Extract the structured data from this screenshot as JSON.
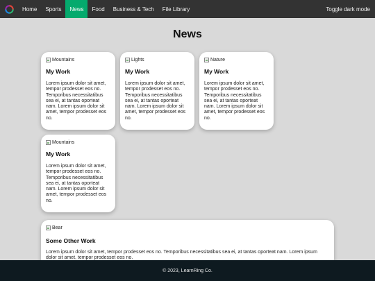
{
  "nav": {
    "items": [
      {
        "label": "Home"
      },
      {
        "label": "Sports"
      },
      {
        "label": "News"
      },
      {
        "label": "Food"
      },
      {
        "label": "Business & Tech"
      },
      {
        "label": "File Library"
      }
    ],
    "active": "News",
    "toggle_label": "Toggle dark mode"
  },
  "page": {
    "title": "News"
  },
  "cards": [
    {
      "image_alt": "Mountains",
      "title": "My Work",
      "text": "Lorem ipsum dolor sit amet, tempor prodesset eos no. Temporibus necessitatibus sea ei, at tantas oporteat nam. Lorem ipsum dolor sit amet, tempor prodesset eos no."
    },
    {
      "image_alt": "Lights",
      "title": "My Work",
      "text": "Lorem ipsum dolor sit amet, tempor prodesset eos no. Temporibus necessitatibus sea ei, at tantas oporteat nam. Lorem ipsum dolor sit amet, tempor prodesset eos no."
    },
    {
      "image_alt": "Nature",
      "title": "My Work",
      "text": "Lorem ipsum dolor sit amet, tempor prodesset eos no. Temporibus necessitatibus sea ei, at tantas oporteat nam. Lorem ipsum dolor sit amet, tempor prodesset eos no."
    },
    {
      "image_alt": "Mountains",
      "title": "My Work",
      "text": "Lorem ipsum dolor sit amet, tempor prodesset eos no. Temporibus necessitatibus sea ei, at tantas oporteat nam. Lorem ipsum dolor sit amet, tempor prodesset eos no."
    },
    {
      "image_alt": "Bear",
      "title": "Some Other Work",
      "text": "Lorem ipsum dolor sit amet, tempor prodesset eos no. Temporibus necessitatibus sea ei, at tantas oporteat nam. Lorem ipsum dolor sit amet, tempor prodesset eos no."
    }
  ],
  "footer": {
    "text": "© 2023, LearnRing Co."
  },
  "colors": {
    "nav_bg": "#333333",
    "active": "#04aa6d",
    "footer_bg": "#0e1a20",
    "page_bg": "#d9d9d9"
  },
  "icons": {
    "logo": "ring-logo-icon",
    "broken_image": "broken-image-icon"
  }
}
